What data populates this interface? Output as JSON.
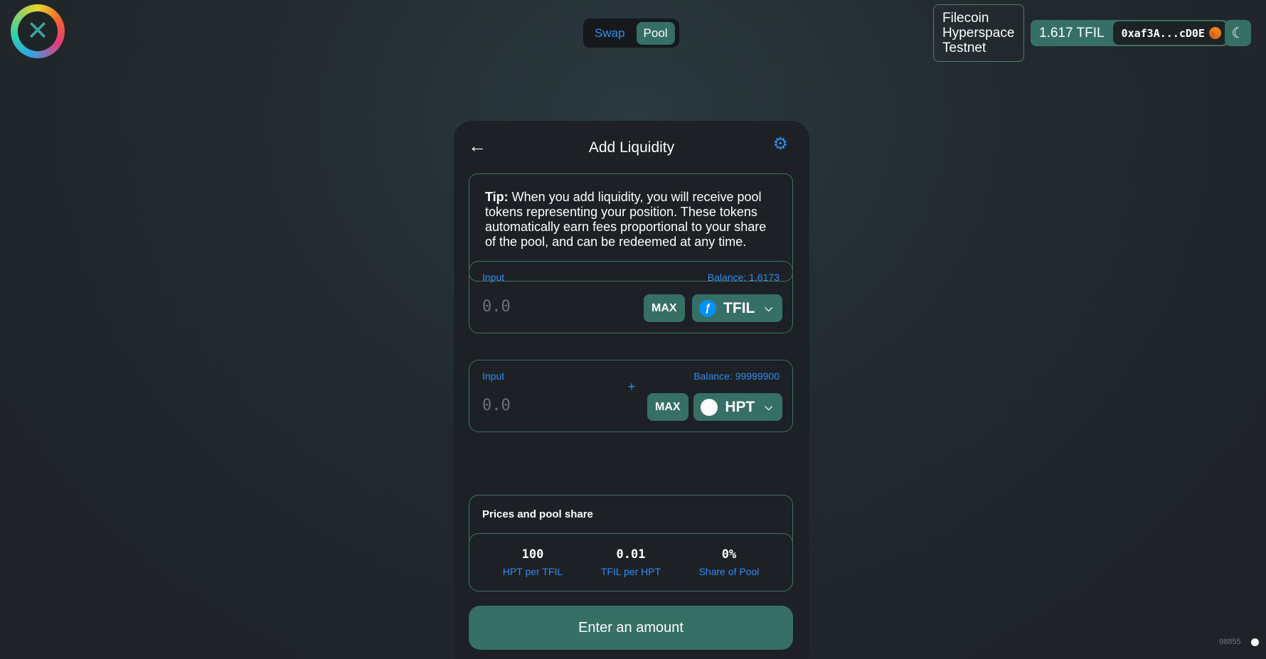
{
  "nav": {
    "tabs": [
      {
        "label": "Swap"
      },
      {
        "label": "Pool"
      }
    ]
  },
  "network": {
    "name_line1": "Filecoin",
    "name_line2": "Hyperspace",
    "name_line3": "Testnet"
  },
  "account": {
    "balance": "1.617 TFIL",
    "address": "0xaf3A...cD0E"
  },
  "card": {
    "title": "Add Liquidity",
    "tip_bold": "Tip:",
    "tip_text": " When you add liquidity, you will receive pool tokens representing your position. These tokens automatically earn fees proportional to your share of the pool, and can be redeemed at any time."
  },
  "input1": {
    "label": "Input",
    "balance": "Balance: 1.6173",
    "placeholder": "0.0",
    "max_label": "MAX",
    "token": "TFIL"
  },
  "plus": "+",
  "input2": {
    "label": "Input",
    "balance": "Balance: 99999900",
    "placeholder": "0.0",
    "max_label": "MAX",
    "token": "HPT"
  },
  "prices": {
    "title": "Prices and pool share",
    "items": [
      {
        "value": "100",
        "label": "HPT per TFIL"
      },
      {
        "value": "0.01",
        "label": "TFIL per HPT"
      },
      {
        "value": "0%",
        "label": "Share of Pool"
      }
    ]
  },
  "submit_label": "Enter an amount",
  "footer": {
    "block_number": "98855"
  },
  "colors": {
    "accent": "#366f66",
    "link": "#2f8df0",
    "card": "#1d2024"
  }
}
